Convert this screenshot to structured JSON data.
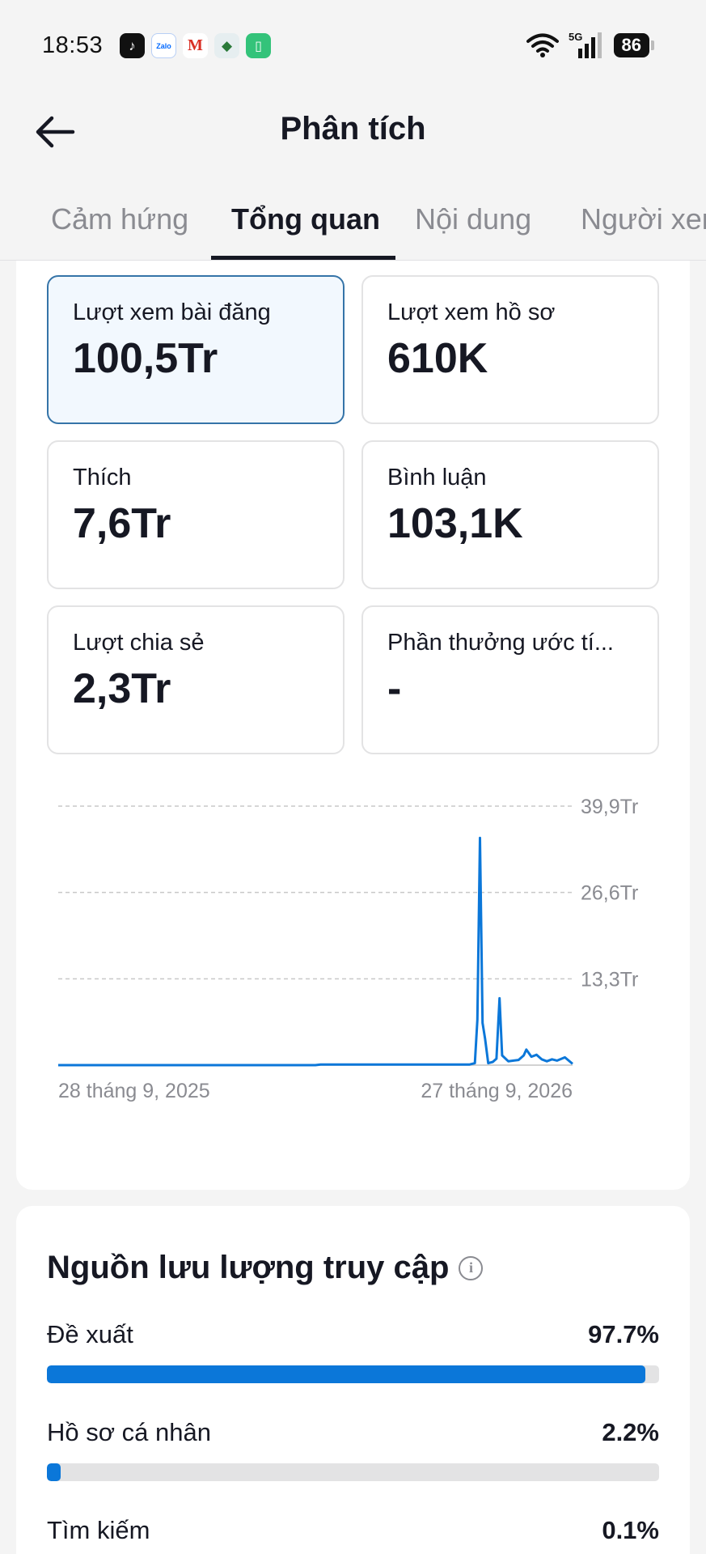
{
  "status_bar": {
    "time": "18:53",
    "network": "5G",
    "battery": "86",
    "app_icons": [
      "tiktok-icon",
      "zalo-icon",
      "gmail-icon",
      "shield-icon",
      "battery-saver-icon"
    ]
  },
  "header": {
    "title": "Phân tích",
    "back_icon": "arrow-left-icon"
  },
  "tabs": [
    {
      "label": "Cảm hứng",
      "active": false
    },
    {
      "label": "Tổng quan",
      "active": true
    },
    {
      "label": "Nội dung",
      "active": false
    },
    {
      "label": "Người xem",
      "active": false
    }
  ],
  "stats": [
    {
      "label": "Lượt xem bài đăng",
      "value": "100,5Tr",
      "selected": true
    },
    {
      "label": "Lượt xem hồ sơ",
      "value": "610K",
      "selected": false
    },
    {
      "label": "Thích",
      "value": "7,6Tr",
      "selected": false
    },
    {
      "label": "Bình luận",
      "value": "103,1K",
      "selected": false
    },
    {
      "label": "Lượt chia sẻ",
      "value": "2,3Tr",
      "selected": false
    },
    {
      "label": "Phần thưởng ước tí...",
      "value": "-",
      "selected": false
    }
  ],
  "chart_data": {
    "type": "line",
    "x_start_label": "28 tháng 9, 2025",
    "x_end_label": "27 tháng 9, 2026",
    "y_ticks": [
      "13,3Tr",
      "26,6Tr",
      "39,9Tr"
    ],
    "ylim": [
      0,
      39.9
    ],
    "y_unit": "Tr",
    "grid": true,
    "line_color": "#0b77d9",
    "series": [
      {
        "points": [
          [
            0.0,
            0
          ],
          [
            0.5,
            0
          ],
          [
            0.51,
            0.1
          ],
          [
            0.8,
            0.1
          ],
          [
            0.81,
            0.3
          ],
          [
            0.815,
            7
          ],
          [
            0.82,
            35
          ],
          [
            0.825,
            6.5
          ],
          [
            0.83,
            4
          ],
          [
            0.836,
            0.3
          ],
          [
            0.845,
            0.5
          ],
          [
            0.852,
            1
          ],
          [
            0.858,
            10.3
          ],
          [
            0.863,
            1.5
          ],
          [
            0.875,
            0.6
          ],
          [
            0.895,
            0.8
          ],
          [
            0.905,
            1.5
          ],
          [
            0.91,
            2.4
          ],
          [
            0.92,
            1.3
          ],
          [
            0.93,
            1.6
          ],
          [
            0.94,
            0.9
          ],
          [
            0.95,
            0.6
          ],
          [
            0.96,
            0.9
          ],
          [
            0.97,
            0.7
          ],
          [
            0.985,
            1.2
          ],
          [
            1.0,
            0.2
          ]
        ]
      }
    ]
  },
  "traffic": {
    "title": "Nguồn lưu lượng truy cập",
    "info_icon": "info-icon",
    "sources": [
      {
        "name": "Đề xuất",
        "percent": "97.7%",
        "value": 97.7
      },
      {
        "name": "Hồ sơ cá nhân",
        "percent": "2.2%",
        "value": 2.2
      },
      {
        "name": "Tìm kiếm",
        "percent": "0.1%",
        "value": 0.1
      }
    ]
  }
}
